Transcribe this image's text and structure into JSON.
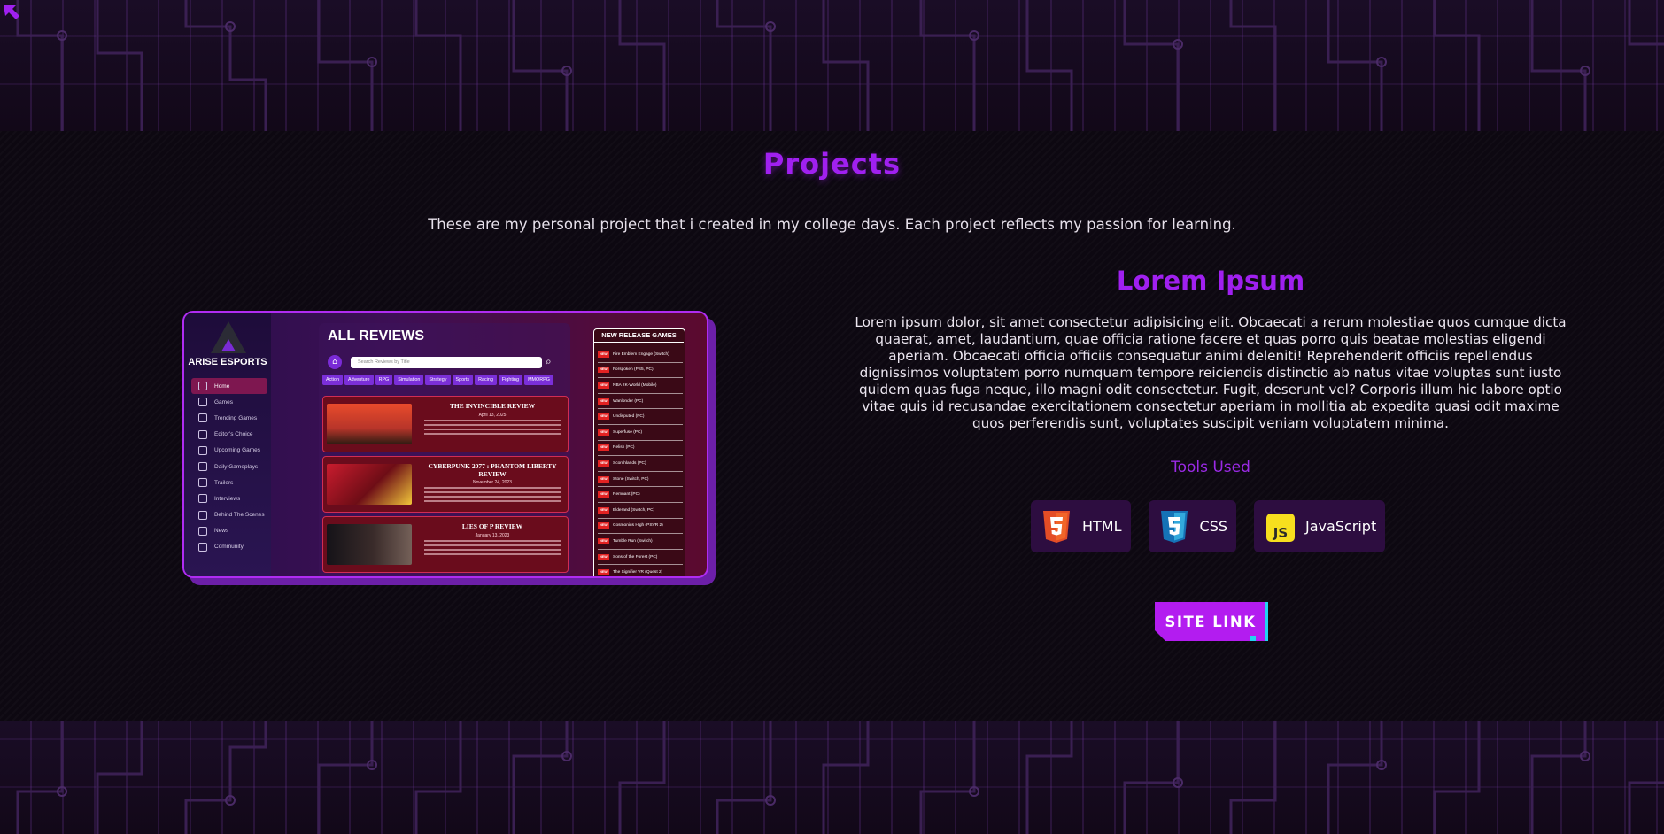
{
  "section": {
    "title": "Projects",
    "subtitle": "These are my personal project that i created in my college days. Each project reflects my passion for learning."
  },
  "project": {
    "title": "Lorem Ipsum",
    "description": "Lorem ipsum dolor, sit amet consectetur adipisicing elit. Obcaecati a rerum molestiae quos cumque dicta quaerat, amet, laudantium, quae officia ratione facere et quas porro quis beatae molestias eligendi aperiam. Obcaecati officia officiis consequatur animi deleniti! Reprehenderit officiis repellendus dignissimos voluptatem porro numquam tempore reiciendis distinctio ab natus vitae voluptas sunt iusto quidem quas fuga neque, illo magni odit consectetur. Fugit, deserunt vel? Corporis illum hic labore optio vitae quis id recusandae exercitationem consectetur aperiam in mollitia ab expedita quasi odit maxime quos perferendis sunt, voluptates suscipit veniam voluptatem minima.",
    "tools_label": "Tools Used",
    "tools": [
      {
        "label": "HTML",
        "icon": "html5-icon",
        "color": "#e44d26"
      },
      {
        "label": "CSS",
        "icon": "css3-icon",
        "color": "#1572b6"
      },
      {
        "label": "JavaScript",
        "icon": "javascript-icon",
        "color": "#f7df1e"
      }
    ],
    "site_link_label": "SITE LINK"
  },
  "preview": {
    "brand": "ARISE ESPORTS",
    "nav": [
      "Home",
      "Games",
      "Trending Games",
      "Editor's Choice",
      "Upcoming Games",
      "Daily Gameplays",
      "Trailers",
      "Interviews",
      "Behind The Scenes",
      "News",
      "Community"
    ],
    "page_title": "ALL REVIEWS",
    "search_placeholder": "Search Reviews by Title",
    "categories": [
      "Action",
      "Adventure",
      "RPG",
      "Simulation",
      "Strategy",
      "Sports",
      "Racing",
      "Fighting",
      "MMORPG"
    ],
    "reviews": [
      {
        "title": "THE INVINCIBLE REVIEW",
        "date": "April 13, 2025"
      },
      {
        "title": "CYBERPUNK 2077 : PHANTOM LIBERTY REVIEW",
        "date": "November 24, 2023"
      },
      {
        "title": "LIES OF P REVIEW",
        "date": "January 13, 2023"
      }
    ],
    "releases_title": "NEW RELEASE GAMES",
    "release_badge": "NEW",
    "releases": [
      "Fire Emblem Engage (Switch)",
      "Forspoken (PS5, PC)",
      "NBA 2K-World (Mobile)",
      "Wanlonder (PC)",
      "Undisputed (PC)",
      "Superfuse (PC)",
      "Relish (PC)",
      "Scorchlands (PC)",
      "Stone (Switch, PC)",
      "Remnant (PC)",
      "Elderand (Switch, PC)",
      "Cosmonius High (PSVR 2)",
      "Tumble Run (Switch)",
      "Sons of the Forest (PC)",
      "The Signifier VR (Quest 2)"
    ]
  },
  "colors": {
    "accent": "#a020f0",
    "button": "#b31cf0",
    "button_edge": "#22d3f0",
    "background": "#0d0811"
  }
}
